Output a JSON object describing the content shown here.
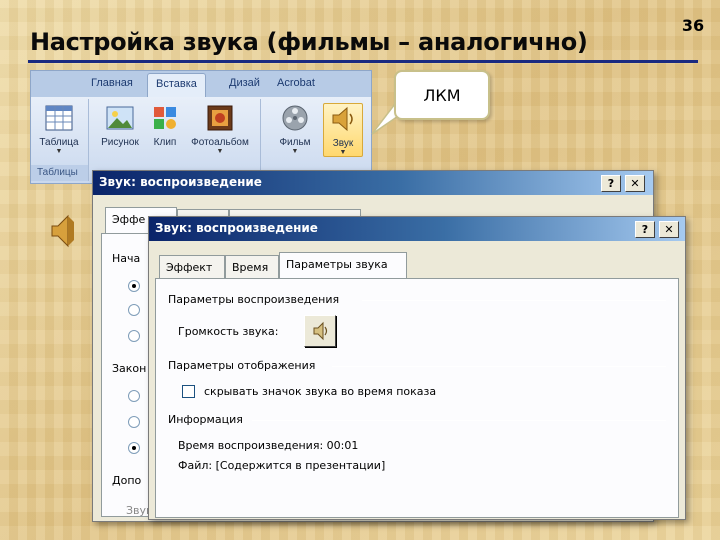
{
  "slide": {
    "number": "36",
    "title": "Настройка звука (фильмы – аналогично)",
    "callout": "ЛКМ"
  },
  "ribbon": {
    "tabs": [
      "Главная",
      "Вставка",
      "Дизай",
      "Acrobat"
    ],
    "active_tab": "Вставка",
    "buttons": {
      "table": "Таблица",
      "picture": "Рисунок",
      "clip": "Клип",
      "photo_album": "Фотоальбом",
      "movie": "Фильм",
      "sound": "Звук"
    },
    "group_tables": "Таблицы"
  },
  "back_dialog": {
    "title": "Звук: воспроизведение",
    "tab_effect": "Эффе",
    "labels": {
      "start": "Нача",
      "end": "Закон",
      "extra": "Допо",
      "sound": "Звук"
    },
    "help_button": "?",
    "close_button": "✕"
  },
  "front_dialog": {
    "title": "Звук: воспроизведение",
    "help_button": "?",
    "close_button": "✕",
    "tabs": [
      "Эффект",
      "Время",
      "Параметры звука"
    ],
    "active_tab": "Параметры звука",
    "playback_section": "Параметры воспроизведения",
    "volume_label": "Громкость звука:",
    "display_section": "Параметры отображения",
    "hide_icon_label": "скрывать значок звука во время показа",
    "hide_icon_checked": false,
    "info_section": "Информация",
    "playback_time": "Время воспроизведения:   00:01",
    "file": "Файл:  [Содержится в презентации]"
  },
  "colors": {
    "title_rule": "#1a2a80",
    "titlebar_start": "#0a246a",
    "titlebar_end": "#a6caf0",
    "dialog_face": "#ece9d8"
  }
}
